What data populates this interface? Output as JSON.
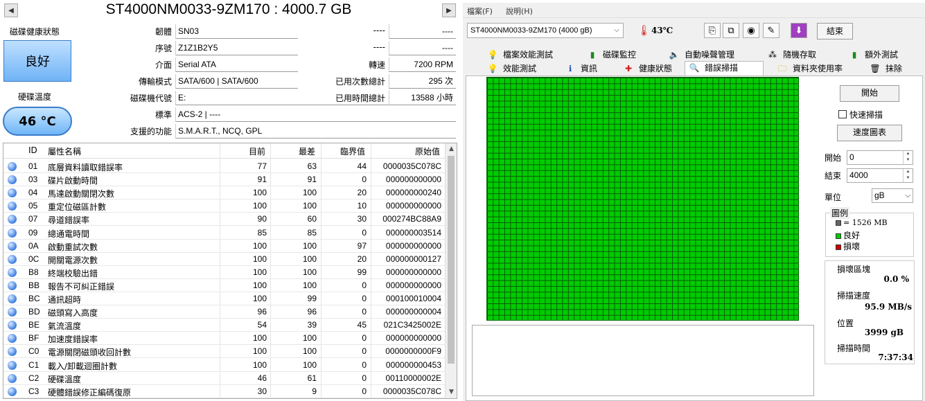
{
  "left": {
    "title": "ST4000NM0033-9ZM170 : 4000.7 GB",
    "health_label": "磁碟健康狀態",
    "health_value": "良好",
    "temp_label": "硬碟溫度",
    "temp_value": "46 °C",
    "fields": {
      "firmware_label": "韌體",
      "firmware": "SN03",
      "serial_label": "序號",
      "serial": "Z1Z1B2Y5",
      "interface_label": "介面",
      "interface": "Serial ATA",
      "transfer_label": "傳輸模式",
      "transfer": "SATA/600 | SATA/600",
      "drive_letter_label": "磁碟機代號",
      "drive_letter": "E:",
      "standard_label": "標準",
      "standard": "ACS-2 | ----",
      "features_label": "支援的功能",
      "features": "S.M.A.R.T., NCQ, GPL",
      "dash1": "----",
      "dash2": "----",
      "dash3": "----",
      "dash4": "----",
      "rotation_label": "轉速",
      "rotation": "7200 RPM",
      "power_count_label": "已用次數總計",
      "power_count": "295 次",
      "power_hours_label": "已用時間總計",
      "power_hours": "13588 小時"
    },
    "smart_headers": {
      "id": "ID",
      "name": "屬性名稱",
      "current": "目前",
      "worst": "最差",
      "threshold": "臨界值",
      "raw": "原始值"
    },
    "smart_rows": [
      {
        "id": "01",
        "name": "底層資料讀取錯誤率",
        "cur": "77",
        "worst": "63",
        "thr": "44",
        "raw": "0000035C078C"
      },
      {
        "id": "03",
        "name": "碟片啟動時間",
        "cur": "91",
        "worst": "91",
        "thr": "0",
        "raw": "000000000000"
      },
      {
        "id": "04",
        "name": "馬達啟動關閉次數",
        "cur": "100",
        "worst": "100",
        "thr": "20",
        "raw": "000000000240"
      },
      {
        "id": "05",
        "name": "重定位磁區計數",
        "cur": "100",
        "worst": "100",
        "thr": "10",
        "raw": "000000000000"
      },
      {
        "id": "07",
        "name": "尋道錯誤率",
        "cur": "90",
        "worst": "60",
        "thr": "30",
        "raw": "000274BC88A9"
      },
      {
        "id": "09",
        "name": "總通電時間",
        "cur": "85",
        "worst": "85",
        "thr": "0",
        "raw": "000000003514"
      },
      {
        "id": "0A",
        "name": "啟動重試次數",
        "cur": "100",
        "worst": "100",
        "thr": "97",
        "raw": "000000000000"
      },
      {
        "id": "0C",
        "name": "開關電源次數",
        "cur": "100",
        "worst": "100",
        "thr": "20",
        "raw": "000000000127"
      },
      {
        "id": "B8",
        "name": "終端校驗出錯",
        "cur": "100",
        "worst": "100",
        "thr": "99",
        "raw": "000000000000"
      },
      {
        "id": "BB",
        "name": "報告不可糾正錯誤",
        "cur": "100",
        "worst": "100",
        "thr": "0",
        "raw": "000000000000"
      },
      {
        "id": "BC",
        "name": "通訊超時",
        "cur": "100",
        "worst": "99",
        "thr": "0",
        "raw": "000100010004"
      },
      {
        "id": "BD",
        "name": "磁頭寫入高度",
        "cur": "96",
        "worst": "96",
        "thr": "0",
        "raw": "000000000004"
      },
      {
        "id": "BE",
        "name": "氣流溫度",
        "cur": "54",
        "worst": "39",
        "thr": "45",
        "raw": "021C3425002E"
      },
      {
        "id": "BF",
        "name": "加速度錯誤率",
        "cur": "100",
        "worst": "100",
        "thr": "0",
        "raw": "000000000000"
      },
      {
        "id": "C0",
        "name": "電源關閉磁頭收回計數",
        "cur": "100",
        "worst": "100",
        "thr": "0",
        "raw": "0000000000F9"
      },
      {
        "id": "C1",
        "name": "載入/卸載迴圈計數",
        "cur": "100",
        "worst": "100",
        "thr": "0",
        "raw": "000000000453"
      },
      {
        "id": "C2",
        "name": "硬碟溫度",
        "cur": "46",
        "worst": "61",
        "thr": "0",
        "raw": "00110000002E"
      },
      {
        "id": "C3",
        "name": "硬體錯誤修正編碼復原",
        "cur": "30",
        "worst": "9",
        "thr": "0",
        "raw": "0000035C078C"
      }
    ]
  },
  "right": {
    "menu": [
      "檔案(F)",
      "說明(H)"
    ],
    "drive": "ST4000NM0033-9ZM170 (4000 gB)",
    "temperature": "43℃",
    "exit": "結束",
    "tabs_top": [
      "檔案效能測試",
      "磁碟監控",
      "自動噪聲管理",
      "隨機存取",
      "額外測試"
    ],
    "tabs_bottom": [
      "效能測試",
      "資訊",
      "健康狀態",
      "錯誤掃描",
      "資料夾使用率",
      "抹除"
    ],
    "start_button": "開始",
    "quick_scan": "快速掃描",
    "speed_map": "速度圖表",
    "start_label": "開始",
    "start_value": "0",
    "end_label": "結束",
    "end_value": "4000",
    "unit_label": "單位",
    "unit_value": "gB",
    "legend_title": "圖例",
    "legend_block": "= 1526 MB",
    "legend_ok": "良好",
    "legend_bad": "損壞",
    "bad_area_label": "損壞區塊",
    "bad_area_value": "0.0 %",
    "speed_label": "掃描速度",
    "speed_value": "95.9 MB/s",
    "position_label": "位置",
    "position_value": "3999 gB",
    "time_label": "掃描時間",
    "time_value": "7:37:34",
    "colors": {
      "ok": "#00cc00",
      "bad": "#d00000",
      "grid_line": "#0a5a0a"
    }
  }
}
